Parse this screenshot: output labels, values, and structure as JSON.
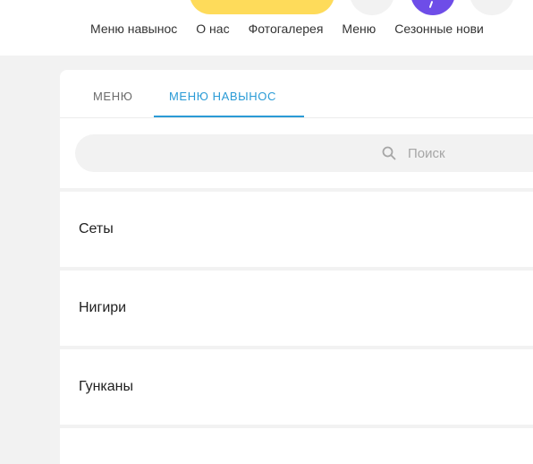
{
  "header": {
    "nav": [
      "Меню навынос",
      "О нас",
      "Фотогалерея",
      "Меню",
      "Сезонные нови"
    ]
  },
  "tabs": [
    {
      "label": "МЕНЮ",
      "active": false
    },
    {
      "label": "МЕНЮ НАВЫНОС",
      "active": true
    }
  ],
  "search": {
    "placeholder": "Поиск"
  },
  "categories": [
    "Сеты",
    "Нигири",
    "Гунканы"
  ],
  "colors": {
    "accent": "#2a9bd6",
    "cta_yellow": "#fedb5a",
    "purple": "#6e4de8",
    "background": "#f2f2f2"
  }
}
